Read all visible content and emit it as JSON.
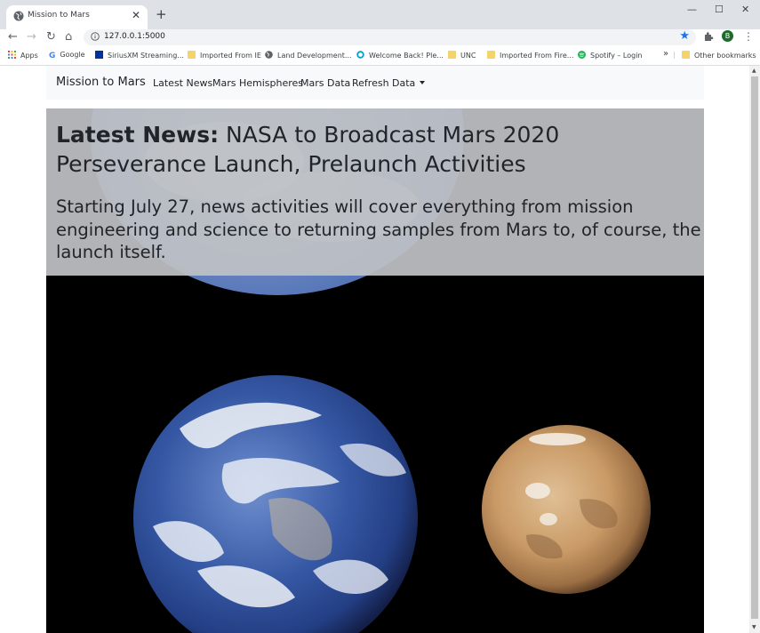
{
  "browser": {
    "tab_title": "Mission to Mars",
    "url": "127.0.0.1:5000",
    "profile_initial": "B",
    "bookmarks": [
      {
        "label": "Apps",
        "icon": "apps-grid-icon"
      },
      {
        "label": "Google",
        "icon": "google-icon"
      },
      {
        "label": "SiriusXM Streaming...",
        "icon": "siriusxm-icon"
      },
      {
        "label": "Imported From IE",
        "icon": "folder-icon"
      },
      {
        "label": "Land Development...",
        "icon": "globe-icon"
      },
      {
        "label": "Welcome Back! Ple...",
        "icon": "circle-logo-icon"
      },
      {
        "label": "UNC",
        "icon": "folder-icon"
      },
      {
        "label": "Imported From Fire...",
        "icon": "folder-icon"
      },
      {
        "label": "Spotify – Login",
        "icon": "spotify-icon"
      }
    ],
    "bookmarks_overflow": "»",
    "other_bookmarks": "Other bookmarks"
  },
  "navbar": {
    "brand": "Mission to Mars",
    "links": [
      "Latest News",
      "Mars Hemispheres",
      "Mars Data",
      "Refresh Data"
    ]
  },
  "news": {
    "label": "Latest News:",
    "title": "NASA to Broadcast Mars 2020 Perseverance Launch, Prelaunch Activities",
    "teaser": "Starting July 27, news activities will cover everything from mission engineering and science to returning samples from Mars to, of course, the launch itself."
  },
  "colors": {
    "accent": "#1a73e8",
    "navbar_bg": "#f8f9fa",
    "jumbotron_bg": "#bec1c4",
    "hero_bg": "#000000"
  }
}
